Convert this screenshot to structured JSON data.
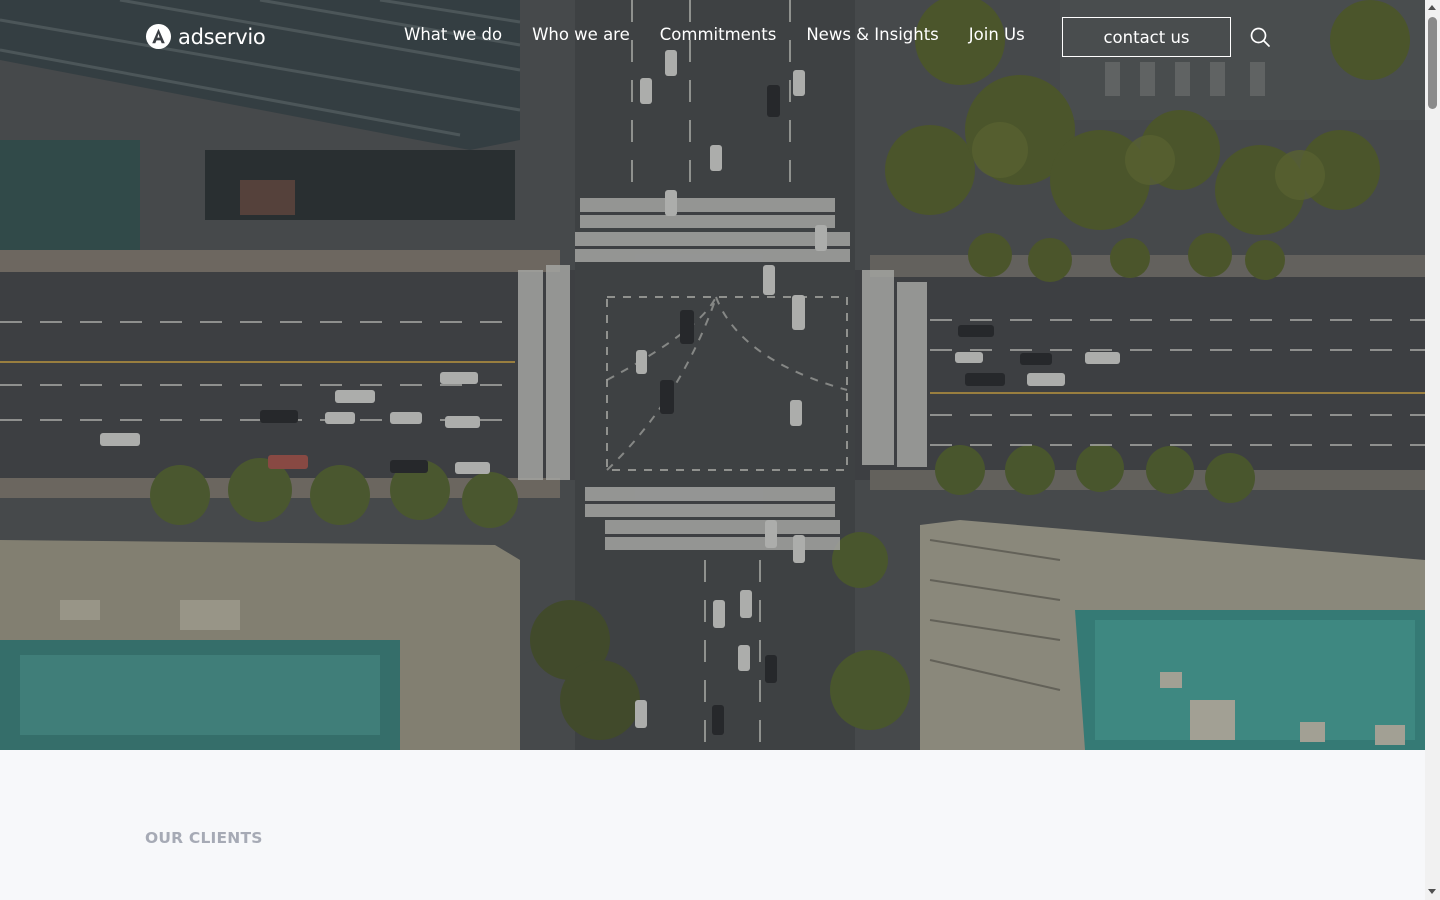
{
  "brand": {
    "name": "adservio",
    "logo_icon": "adservio-logo-icon"
  },
  "nav": {
    "items": [
      {
        "label": "What we do"
      },
      {
        "label": "Who we are"
      },
      {
        "label": "Commitments"
      },
      {
        "label": "News & Insights"
      },
      {
        "label": "Join Us"
      }
    ],
    "contact_label": "contact us",
    "search_icon": "search-icon"
  },
  "hero": {
    "image": "aerial-city-intersection"
  },
  "clients": {
    "eyebrow": "OUR CLIENTS"
  },
  "colors": {
    "nav_text": "#ffffff",
    "eyebrow": "#a6aab5",
    "section_bg": "#f7f8fa"
  }
}
